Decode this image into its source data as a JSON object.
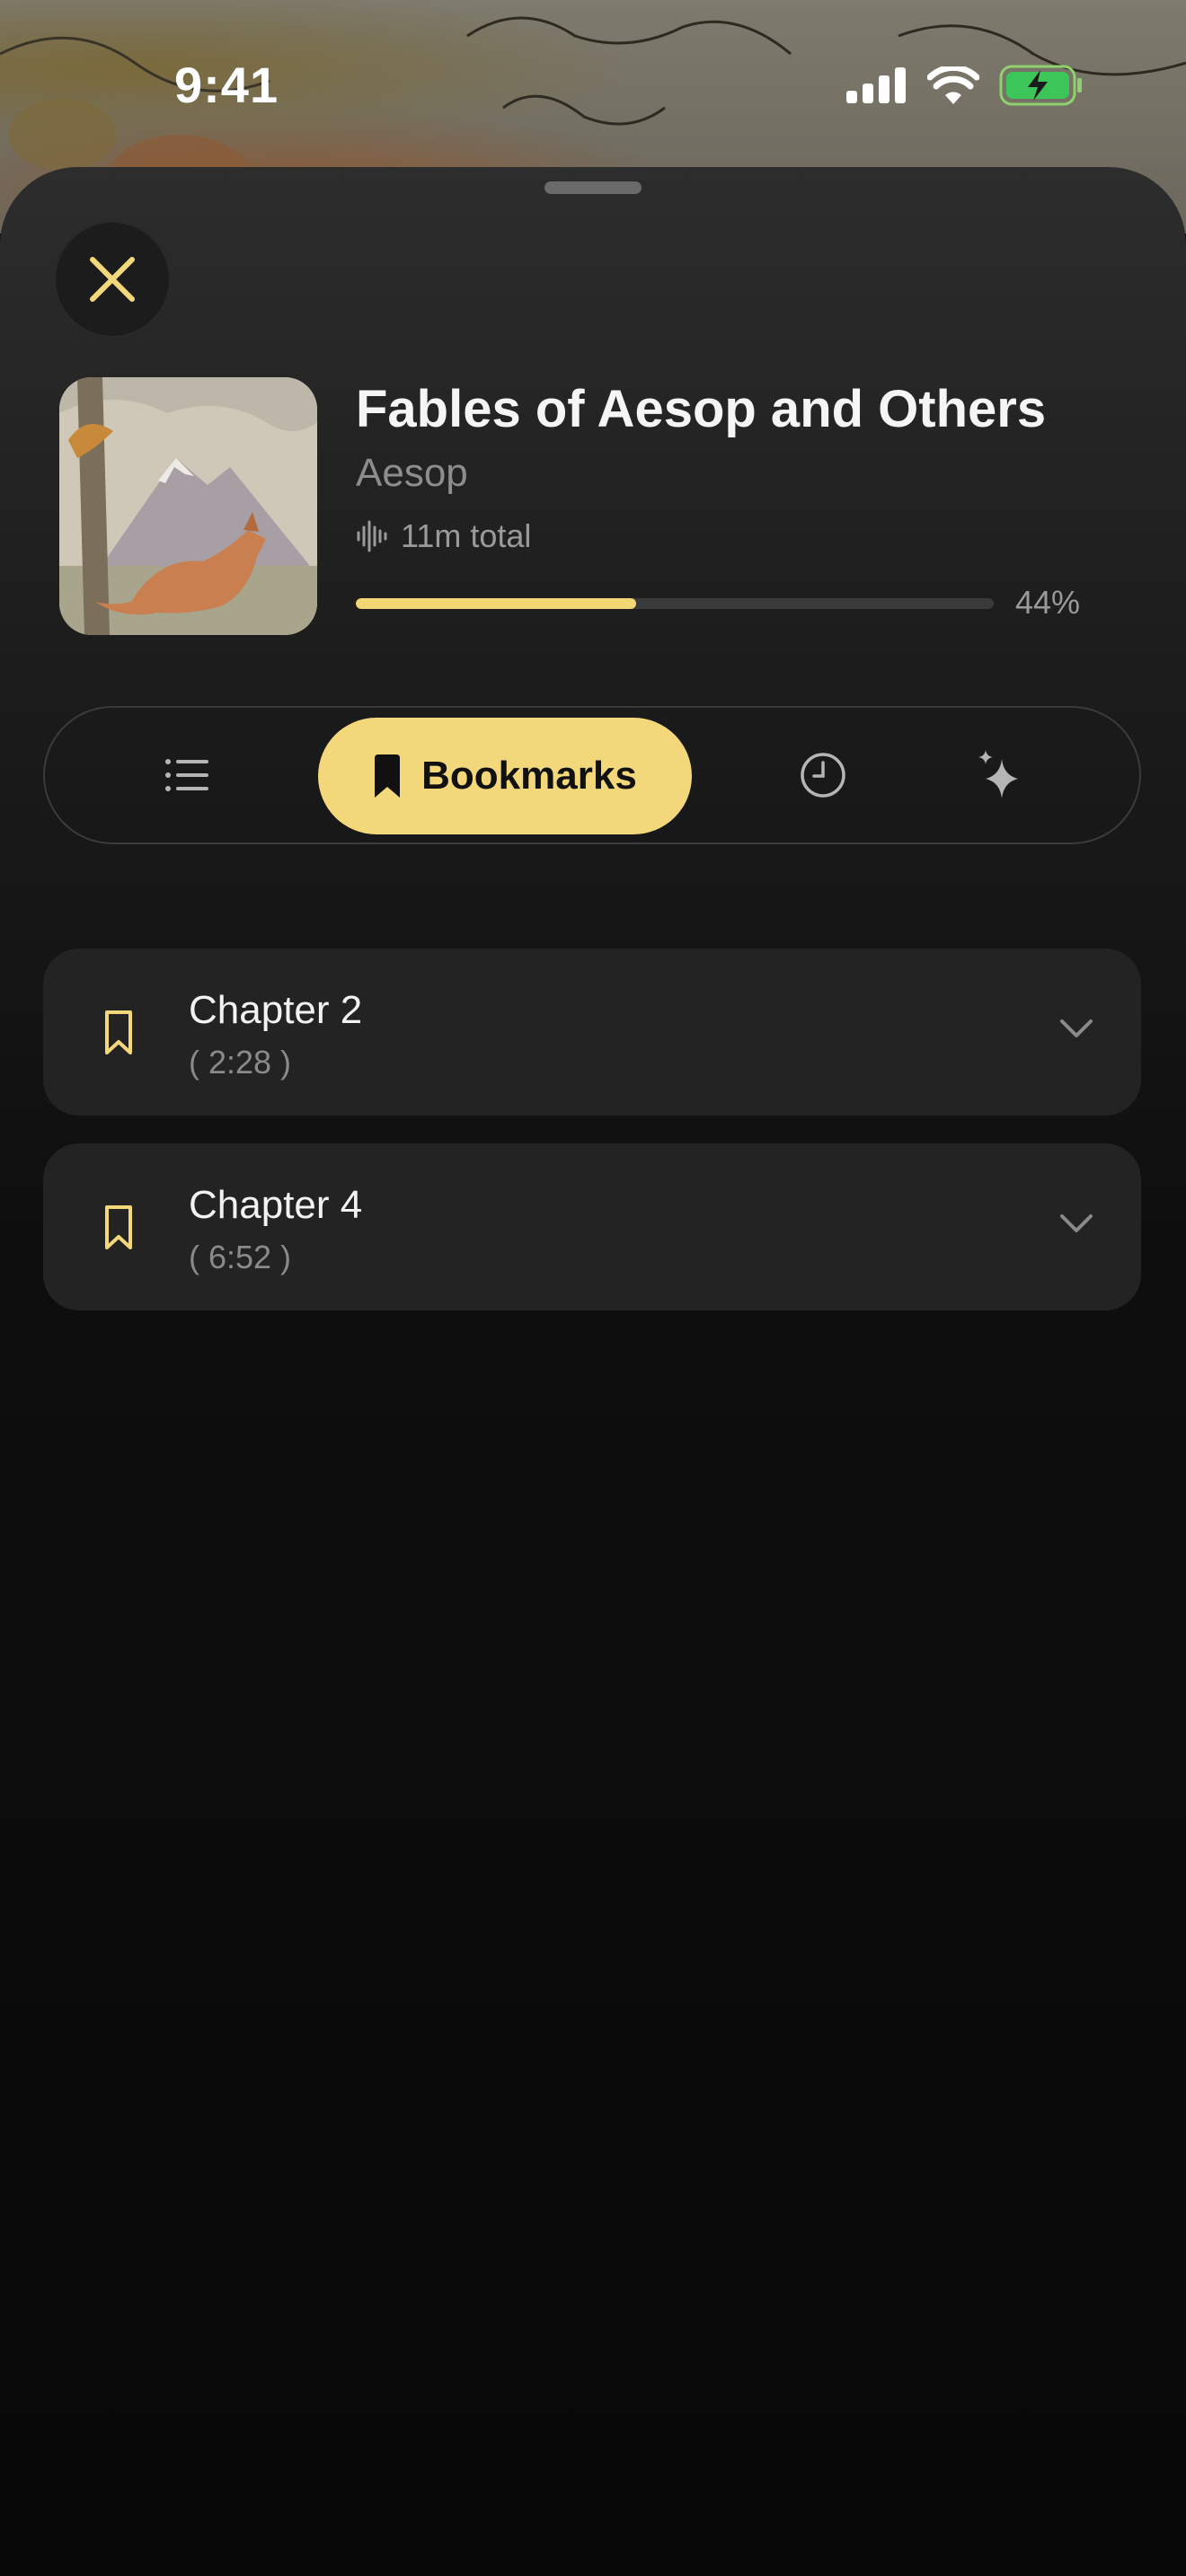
{
  "status_bar": {
    "time": "9:41"
  },
  "book": {
    "title": "Fables of Aesop and Others",
    "author": "Aesop",
    "duration": "11m total",
    "progress_percent": 44,
    "progress_label": "44%"
  },
  "tabs": [
    {
      "id": "chapters",
      "icon": "list-icon",
      "label": ""
    },
    {
      "id": "bookmarks",
      "icon": "bookmark-icon",
      "label": "Bookmarks",
      "selected": true
    },
    {
      "id": "history",
      "icon": "clock-icon",
      "label": ""
    },
    {
      "id": "ai",
      "icon": "sparkle-icon",
      "label": ""
    }
  ],
  "bookmarks": [
    {
      "title": "Chapter 2",
      "time": "( 2:28 )"
    },
    {
      "title": "Chapter 4",
      "time": "( 6:52 )"
    }
  ],
  "colors": {
    "accent": "#f3d87b",
    "sheet_bg": "#1b1b1b",
    "row_bg": "#232323"
  }
}
